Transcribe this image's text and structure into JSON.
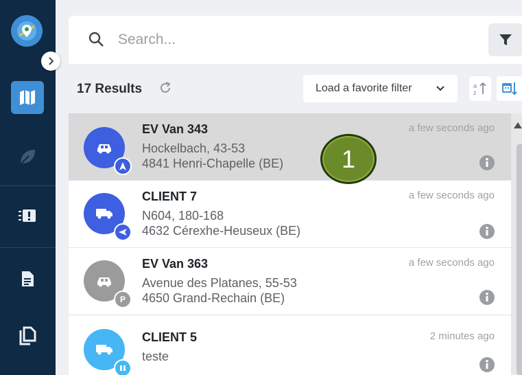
{
  "colors": {
    "rail": "#0f2a44",
    "accent": "#3f8fd6",
    "avatar_blue": "#3d5fe0",
    "avatar_gray": "#9b9b9b",
    "avatar_light_blue": "#46b6f4",
    "selected_row": "#d9d9d9",
    "step_marker": "#6b8a2a"
  },
  "sidebar": {
    "logo_icon": "location-pin-icon",
    "expand_icon": "chevron-right-icon",
    "items": [
      {
        "name": "map",
        "icon": "map-icon",
        "active": true
      },
      {
        "name": "eco",
        "icon": "leaf-icon",
        "active": false
      },
      {
        "name": "alerts",
        "icon": "alert-board-icon",
        "active": false
      },
      {
        "name": "report",
        "icon": "document-icon",
        "active": false
      },
      {
        "name": "documents",
        "icon": "copy-icon",
        "active": false
      }
    ]
  },
  "search": {
    "placeholder": "Search...",
    "value": ""
  },
  "results": {
    "count_label": "17 Results",
    "favorite_filter_label": "Load a favorite filter"
  },
  "vehicles": [
    {
      "title": "EV Van 343",
      "line1": "Hockelbach, 43-53",
      "line2": "4841 Henri-Chapelle (BE)",
      "time": "a few seconds ago",
      "avatar_icon": "car-icon",
      "avatar_color": "#3d5fe0",
      "badge": "A",
      "badge_icon": "navigation-icon",
      "selected": true
    },
    {
      "title": "CLIENT 7",
      "line1": "N604, 180-168",
      "line2": "4632 Cérexhe-Heuseux (BE)",
      "time": "a few seconds ago",
      "avatar_icon": "truck-icon",
      "avatar_color": "#3d5fe0",
      "badge": "",
      "badge_icon": "navigation-left-icon",
      "selected": false
    },
    {
      "title": "EV Van 363",
      "line1": "Avenue des Platanes, 55-53",
      "line2": "4650 Grand-Rechain (BE)",
      "time": "a few seconds ago",
      "avatar_icon": "car-icon",
      "avatar_color": "#9b9b9b",
      "badge": "P",
      "badge_icon": "parking-icon",
      "selected": false
    },
    {
      "title": "CLIENT 5",
      "line1": "teste",
      "line2": "",
      "time": "2 minutes ago",
      "avatar_icon": "truck-icon",
      "avatar_color": "#46b6f4",
      "badge": "",
      "badge_icon": "pause-icon",
      "selected": false
    }
  ],
  "step_marker": {
    "label": "1"
  }
}
